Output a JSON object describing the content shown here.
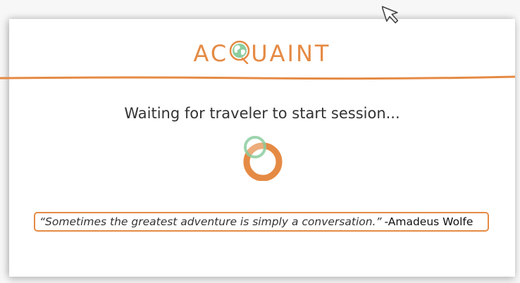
{
  "app": {
    "logo_text_before": "AC",
    "logo_text_after": "UAINT",
    "brand_color": "#e58a44",
    "accent_green": "#8ccda0"
  },
  "status": {
    "message": "Waiting for traveler to start session..."
  },
  "loading": {
    "icon": "spinner-rings-icon"
  },
  "quote": {
    "text": "“Sometimes the greatest adventure is simply a conversation.”",
    "author": "-Amadeus Wolfe"
  },
  "cursor": {
    "icon": "mouse-pointer-icon"
  }
}
